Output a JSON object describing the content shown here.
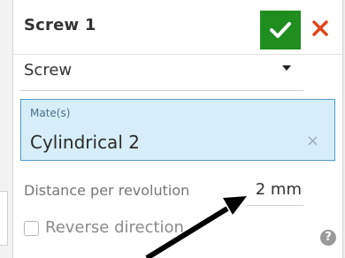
{
  "header": {
    "title": "Screw 1"
  },
  "type_dropdown": {
    "value": "Screw"
  },
  "mates": {
    "label": "Mate(s)",
    "value": "Cylindrical 2",
    "clear_glyph": "×"
  },
  "distance": {
    "label": "Distance per revolution",
    "value": "2 mm"
  },
  "reverse": {
    "label": "Reverse direction",
    "checked": false
  },
  "help": {
    "glyph": "?"
  },
  "colors": {
    "accept": "#1f8e1f",
    "cancel": "#e0451c",
    "selection_fill": "#d6eefa",
    "selection_border": "#4a9dd0"
  },
  "icons": {
    "accept": "checkmark-icon",
    "cancel": "close-icon",
    "dropdown": "caret-down-icon",
    "help": "help-icon"
  }
}
